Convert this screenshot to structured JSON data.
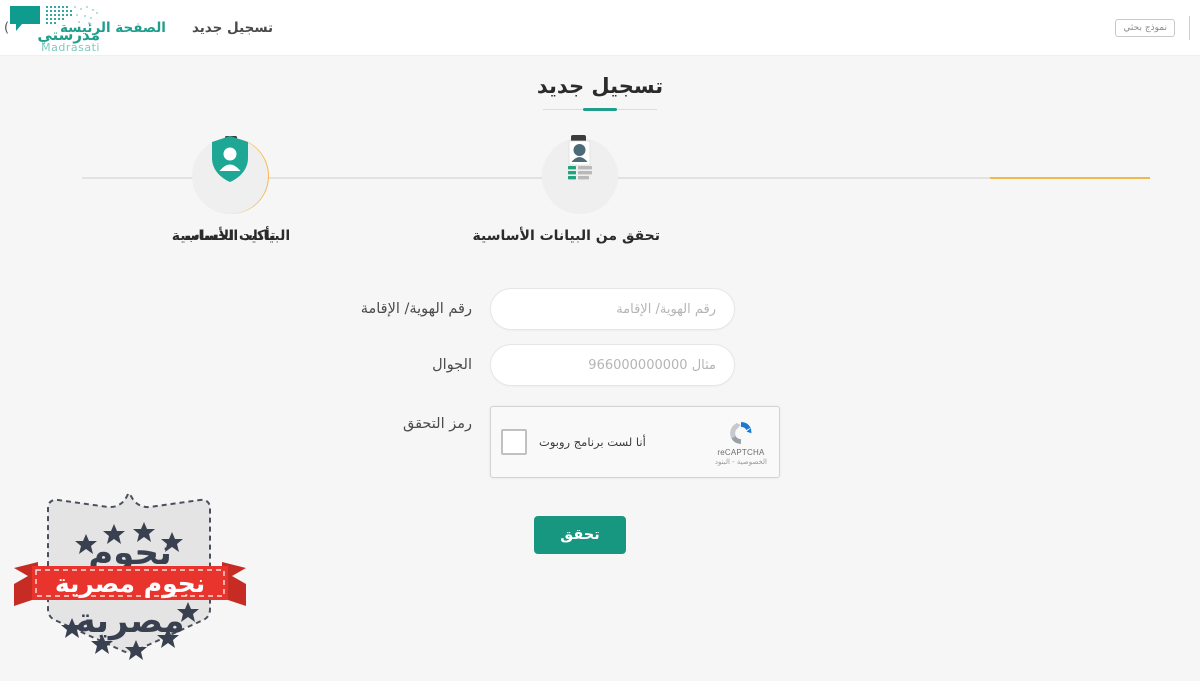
{
  "header": {
    "nav": [
      {
        "label": "الصفحة الرئيسة",
        "state": "active"
      },
      {
        "label": "تسجيل جديد",
        "state": "plain"
      }
    ],
    "lang_button": "نموذج بحثي",
    "edge_text": ")",
    "brand": {
      "arabic": "مدرستي",
      "latin": "Madrasati",
      "icon": "speech-bubble-logo-icon",
      "color": "#1f9e8c"
    }
  },
  "page": {
    "title": "تسجيل جديد",
    "accent_color": "#1f9e8c",
    "background": "#f6f6f6"
  },
  "stepper": {
    "steps": [
      {
        "label": "تأكيد الحساب",
        "state": "pending",
        "icon": "shield-user-icon",
        "circle_color": "#efefef"
      },
      {
        "label": "تحقق من البيانات الأساسية",
        "state": "pending",
        "icon": "id-verification-icon",
        "circle_color": "#efefef"
      },
      {
        "label": "البيانات الأساسية",
        "state": "current",
        "icon": "id-card-icon",
        "circle_color": "#f6b84f"
      }
    ],
    "line_color": "#e2e2e2",
    "active_line_color": "#f0b74a"
  },
  "form": {
    "fields": [
      {
        "label": "رقم الهوية/ الإقامة",
        "placeholder": "رقم الهوية/ الإقامة",
        "value": "",
        "type": "text"
      },
      {
        "label": "الجوال",
        "placeholder": "مثال 966000000000",
        "value": "",
        "type": "tel"
      }
    ],
    "captcha": {
      "label": "رمز التحقق",
      "checkbox_text": "أنا لست برنامج روبوت",
      "brand_name": "reCAPTCHA",
      "legal_text": "الخصوصية - البنود",
      "checked": false
    },
    "submit_label": "تحقق",
    "submit_color": "#17977f"
  },
  "watermark": {
    "ribbon_text": "نجوم مصرية",
    "shield_text_top": "نجوم",
    "shield_text_bottom": "مصرية",
    "ribbon_color": "#e8342c",
    "shield_color": "#e2e2e2"
  }
}
